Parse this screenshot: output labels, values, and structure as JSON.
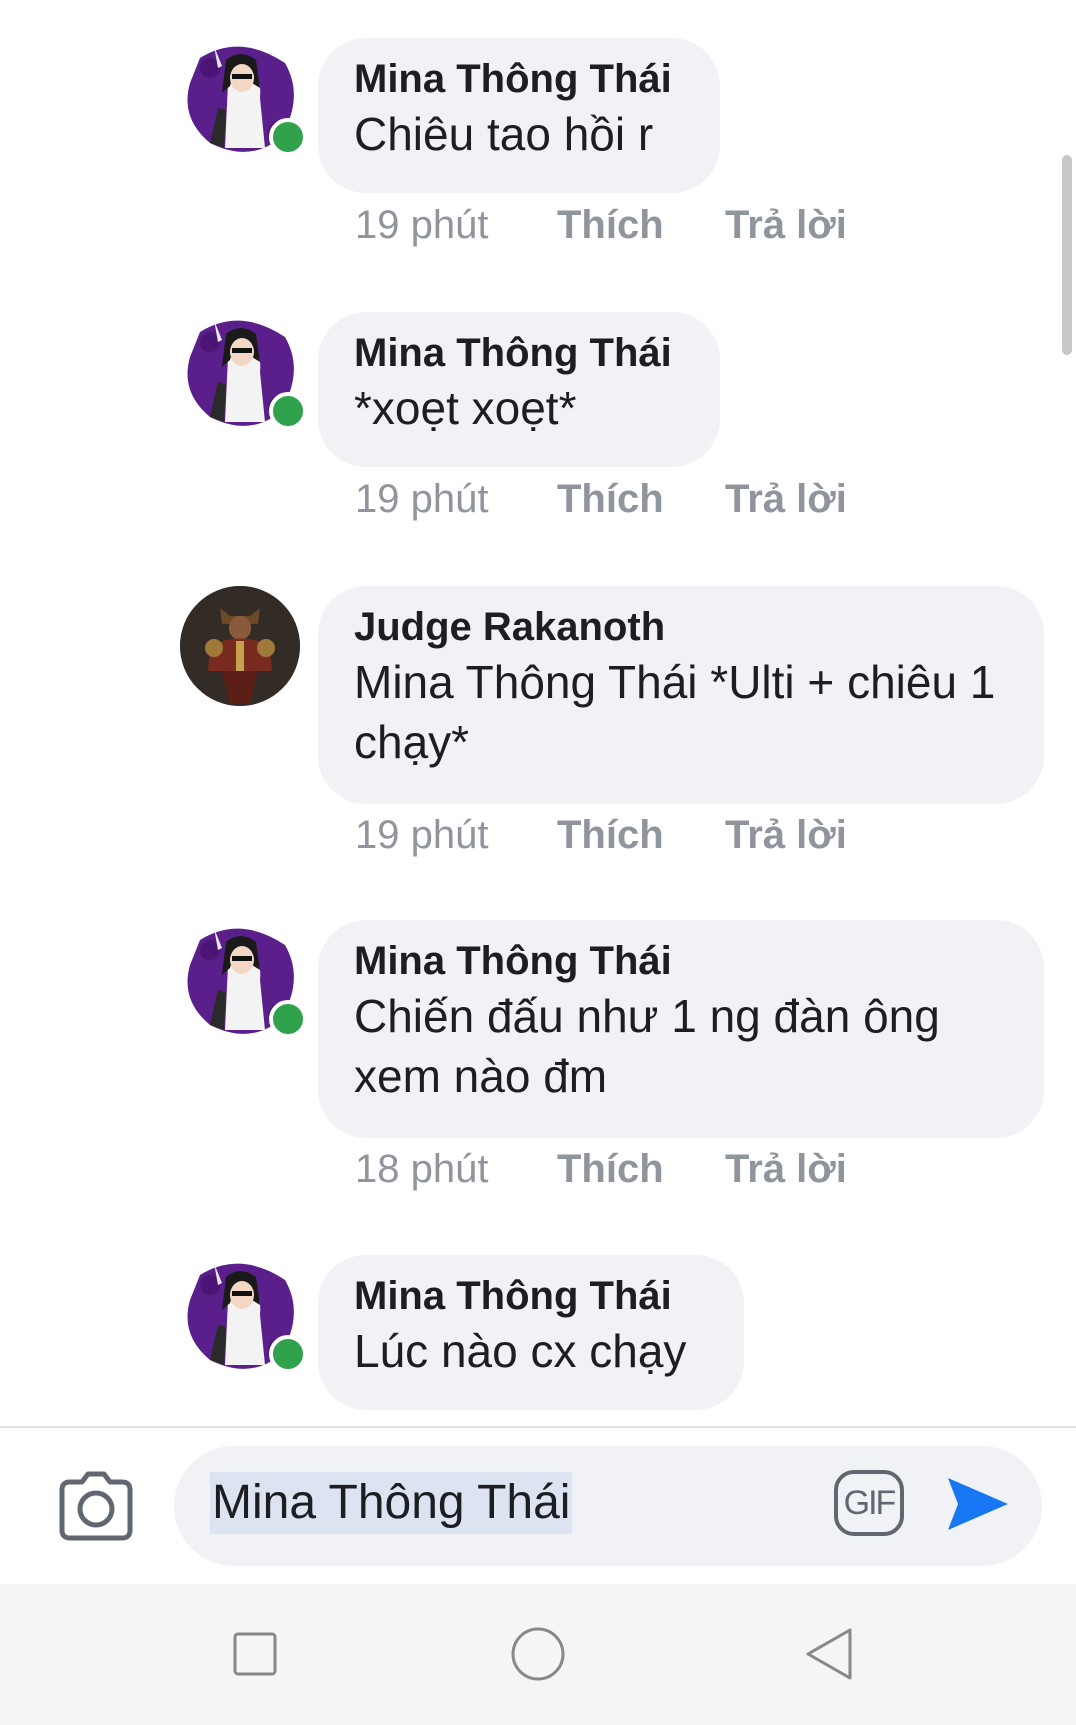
{
  "comments": [
    {
      "author": "Mina Thông Thái",
      "text": "Chiêu tao hồi r",
      "time": "19 phút",
      "like": "Thích",
      "reply": "Trả lời",
      "online": true,
      "avatar": "anime-character-avatar"
    },
    {
      "author": "Mina Thông Thái",
      "text": "*xoẹt xoẹt*",
      "time": "19 phút",
      "like": "Thích",
      "reply": "Trả lời",
      "online": true,
      "avatar": "anime-character-avatar"
    },
    {
      "author": "Judge Rakanoth",
      "text": "Mina Thông Thái *Ulti + chiêu 1 chạy*",
      "time": "19 phút",
      "like": "Thích",
      "reply": "Trả lời",
      "online": false,
      "avatar": "armored-warrior-avatar"
    },
    {
      "author": "Mina Thông Thái",
      "text": "Chiến đấu như 1 ng đàn ông xem nào đm",
      "time": "18 phút",
      "like": "Thích",
      "reply": "Trả lời",
      "online": true,
      "avatar": "anime-character-avatar"
    },
    {
      "author": "Mina Thông Thái",
      "text": "Lúc nào cx chạy",
      "online": true,
      "avatar": "anime-character-avatar"
    }
  ],
  "composer": {
    "input_value": "Mina Thông Thái",
    "gif_label": "GIF",
    "camera_icon": "camera-icon",
    "send_icon": "send-icon"
  },
  "navbar": {
    "icons": [
      "square-recents-icon",
      "circle-home-icon",
      "triangle-back-icon"
    ]
  },
  "colors": {
    "bubble": "#f0f2f5",
    "text": "#1c1e21",
    "meta": "#90949c",
    "online": "#31a24c",
    "send": "#1877f2"
  }
}
